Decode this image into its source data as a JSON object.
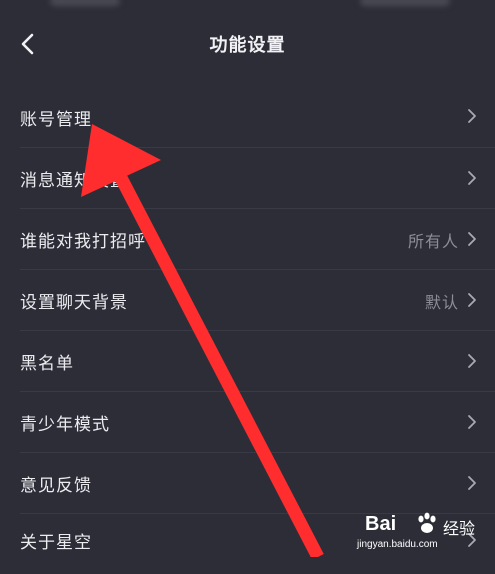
{
  "header": {
    "title": "功能设置",
    "back_icon": "chevron-left-icon"
  },
  "menu": {
    "items": [
      {
        "label": "账号管理",
        "value": ""
      },
      {
        "label": "消息通知设置",
        "value": ""
      },
      {
        "label": "谁能对我打招呼",
        "value": "所有人"
      },
      {
        "label": "设置聊天背景",
        "value": "默认"
      },
      {
        "label": "黑名单",
        "value": ""
      },
      {
        "label": "青少年模式",
        "value": ""
      },
      {
        "label": "意见反馈",
        "value": ""
      },
      {
        "label": "关于星空",
        "value": ""
      }
    ]
  },
  "watermark": {
    "brand": "Bai",
    "suffix": "经验",
    "url": "jingyan.baidu.com"
  },
  "colors": {
    "background": "#2d2d38",
    "divider": "#3a3a46",
    "annotation_arrow": "#ff2d2d"
  }
}
